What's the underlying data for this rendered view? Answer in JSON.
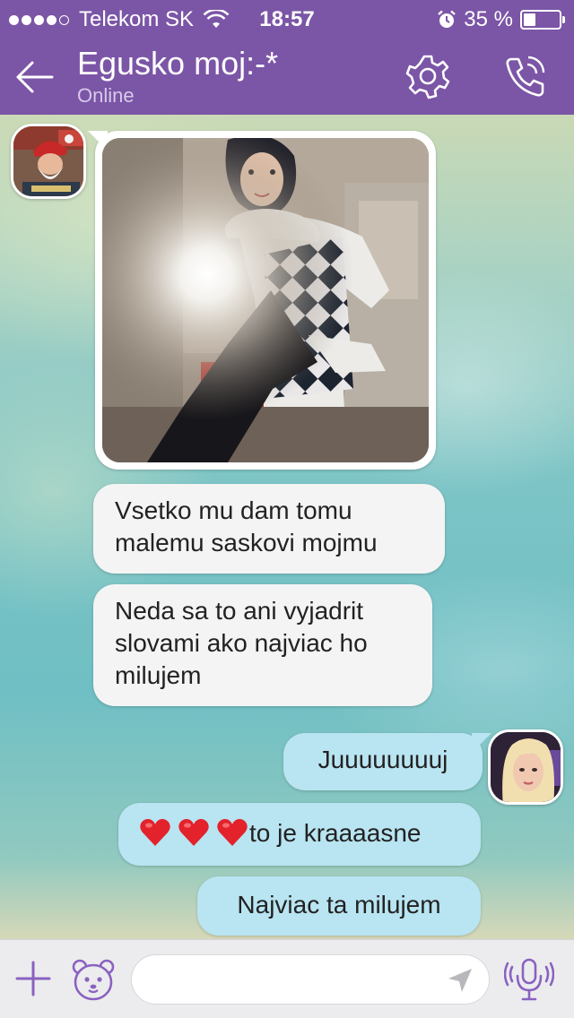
{
  "status_bar": {
    "carrier": "Telekom SK",
    "time": "18:57",
    "battery_percent": "35 %",
    "battery_level": 0.35,
    "signal_bars": 4
  },
  "header": {
    "title": "Egusko moj:-*",
    "subtitle": "Online",
    "icons": [
      "back-arrow-icon",
      "gear-icon",
      "phone-call-icon"
    ],
    "accent_color": "#7b55a6"
  },
  "messages": [
    {
      "side": "incoming",
      "type": "photo"
    },
    {
      "side": "incoming",
      "text": "Vsetko mu dam tomu malemu saskovi mojmu"
    },
    {
      "side": "incoming",
      "text": "Neda sa to ani vyjadrit slovami ako najviac ho milujem"
    },
    {
      "side": "outgoing",
      "text": "Juuuuuuuuj"
    },
    {
      "side": "outgoing",
      "hearts": 3,
      "text": "to je kraaaasne"
    },
    {
      "side": "outgoing",
      "text": "Najviac ta milujem"
    }
  ],
  "bottom_bar": {
    "input_value": "",
    "input_placeholder": "",
    "icons": [
      "plus-icon",
      "sticker-bear-icon",
      "send-arrow-icon",
      "microphone-icon"
    ]
  },
  "colors": {
    "incoming_bubble": "#f4f4f4",
    "outgoing_bubble": "#b9e4f1",
    "icon_purple": "#8a62c0"
  }
}
